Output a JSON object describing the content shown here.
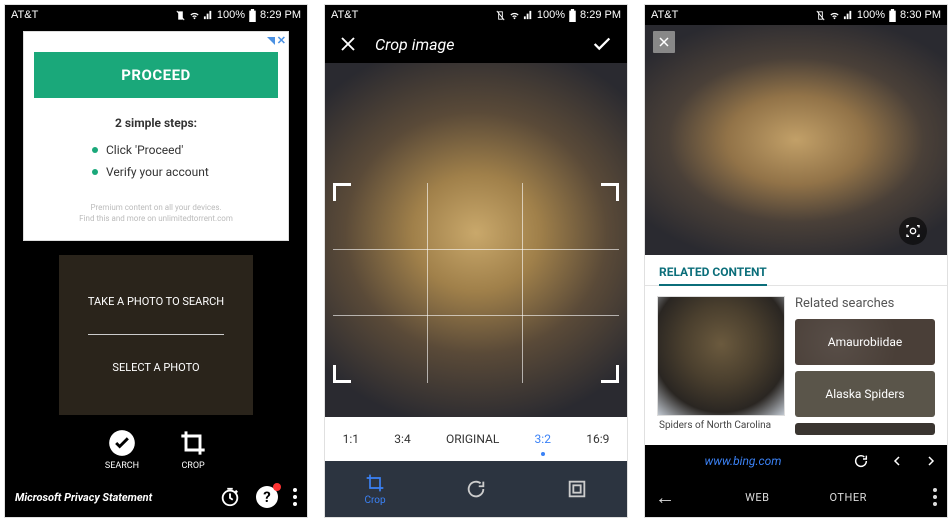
{
  "status": {
    "carrier": "AT&T",
    "battery": "100%",
    "time1": "8:29 PM",
    "time2": "8:29 PM",
    "time3": "8:30 PM"
  },
  "screen1": {
    "ad": {
      "cta": "PROCEED",
      "steps_title": "2 simple steps:",
      "step1": "Click 'Proceed'",
      "step2": "Verify your account",
      "foot1": "Premium content on all your devices.",
      "foot2": "Find this and more on unlimitedtorrent.com"
    },
    "card": {
      "take": "TAKE A PHOTO TO SEARCH",
      "select": "SELECT A PHOTO"
    },
    "actions": {
      "search": "SEARCH",
      "crop": "CROP"
    },
    "footer": {
      "privacy": "Microsoft Privacy Statement"
    }
  },
  "screen2": {
    "title": "Crop image",
    "ratios": {
      "r1": "1:1",
      "r2": "3:4",
      "r3": "ORIGINAL",
      "r4": "3:2",
      "r5": "16:9"
    },
    "tool": {
      "crop": "Crop"
    }
  },
  "screen3": {
    "related_header": "RELATED CONTENT",
    "related_searches": "Related searches",
    "chip1": "Amaurobiidae",
    "chip2": "Alaska Spiders",
    "caption": "Spiders of North Carolina",
    "url": "www.bing.com",
    "tabs": {
      "web": "WEB",
      "other": "OTHER"
    }
  }
}
